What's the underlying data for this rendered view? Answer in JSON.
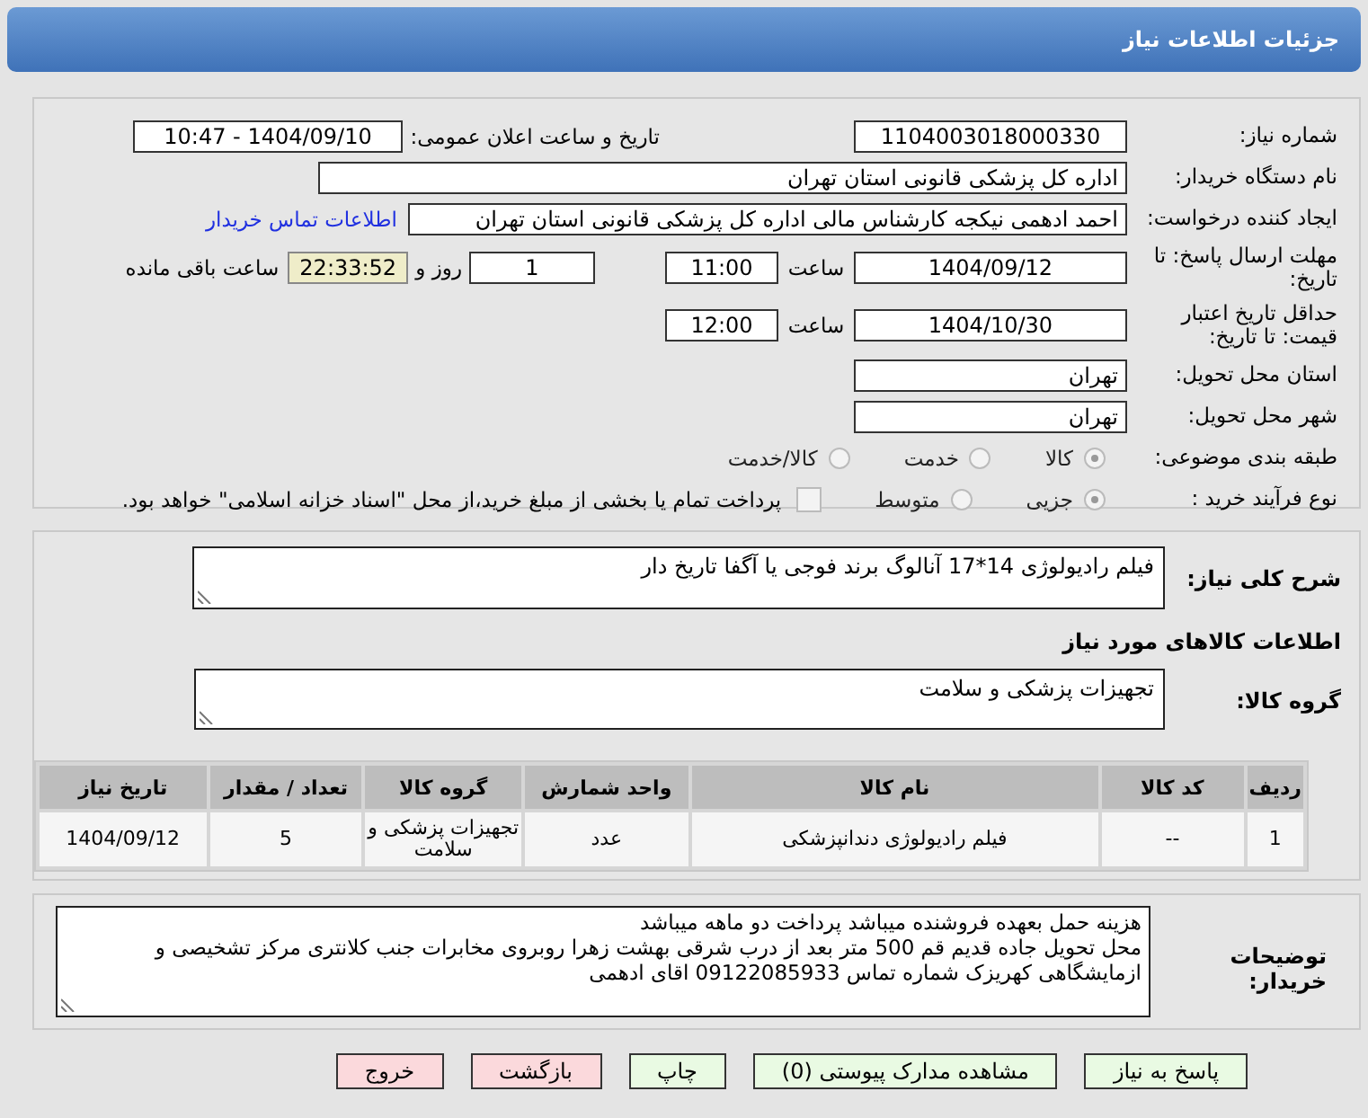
{
  "header": {
    "title": "جزئیات اطلاعات نیاز"
  },
  "need_number": {
    "label": "شماره نیاز:",
    "value": "1104003018000330"
  },
  "announce": {
    "label": "تاریخ و ساعت اعلان عمومی:",
    "value": "1404/09/10 - 10:47"
  },
  "buyer_org": {
    "label": "نام دستگاه خریدار:",
    "value": "اداره کل پزشکی قانونی استان تهران"
  },
  "requester": {
    "label": "ایجاد کننده درخواست:",
    "value": "احمد ادهمی نیکجه کارشناس مالی اداره کل پزشکی قانونی استان تهران",
    "link": "اطلاعات تماس خریدار"
  },
  "reply_deadline": {
    "label": "مهلت ارسال پاسخ: تا تاریخ:",
    "date": "1404/09/12",
    "time_label": "ساعت",
    "time": "11:00",
    "days": "1",
    "days_label": "روز و",
    "remaining": "22:33:52",
    "remaining_label": "ساعت باقی مانده"
  },
  "price_validity": {
    "label": "حداقل تاریخ اعتبار قیمت: تا تاریخ:",
    "date": "1404/10/30",
    "time_label": "ساعت",
    "time": "12:00"
  },
  "province": {
    "label": "استان محل تحویل:",
    "value": "تهران"
  },
  "city": {
    "label": "شهر محل تحویل:",
    "value": "تهران"
  },
  "category": {
    "label": "طبقه بندی موضوعی:",
    "options": [
      {
        "label": "کالا",
        "selected": true
      },
      {
        "label": "خدمت",
        "selected": false
      },
      {
        "label": "کالا/خدمت",
        "selected": false
      }
    ]
  },
  "purchase_type": {
    "label": "نوع فرآیند خرید :",
    "options": [
      {
        "label": "جزیی",
        "selected": true
      },
      {
        "label": "متوسط",
        "selected": false
      }
    ],
    "payment": {
      "checked": false,
      "text": "پرداخت تمام یا بخشی از مبلغ خرید،از محل \"اسناد خزانه اسلامی\" خواهد بود."
    }
  },
  "description": {
    "label": "شرح کلی نیاز:",
    "value": "فیلم رادیولوژی 14*17 آنالوگ برند فوجی یا آگفا تاریخ دار"
  },
  "goods": {
    "title": "اطلاعات کالاهای مورد نیاز",
    "group_label": "گروه کالا:",
    "group_value": "تجهیزات پزشکی و سلامت"
  },
  "table": {
    "columns": [
      "ردیف",
      "کد کالا",
      "نام کالا",
      "واحد شمارش",
      "گروه کالا",
      "تعداد / مقدار",
      "تاریخ نیاز"
    ],
    "rows": [
      [
        "1",
        "--",
        "فیلم رادیولوژی دندانپزشکی",
        "عدد",
        "تجهیزات پزشکی و سلامت",
        "5",
        "1404/09/12"
      ]
    ]
  },
  "notes": {
    "label": "توضیحات خریدار:",
    "lines": [
      "هزینه حمل بعهده فروشنده میباشد پرداخت دو ماهه میباشد",
      "محل تحویل جاده قدیم قم 500 متر بعد از درب شرقی بهشت زهرا روبروی مخابرات جنب کلانتری مرکز تشخیصی و",
      "ازمایشگاهی کهریزک شماره تماس 09122085933 اقای ادهمی"
    ]
  },
  "buttons": [
    {
      "label": "پاسخ به نیاز",
      "kind": "action"
    },
    {
      "label": "مشاهده مدارک پیوستی (0)",
      "kind": "action"
    },
    {
      "label": "چاپ",
      "kind": "action"
    },
    {
      "label": "بازگشت",
      "kind": "exit"
    },
    {
      "label": "خروج",
      "kind": "exit"
    }
  ]
}
